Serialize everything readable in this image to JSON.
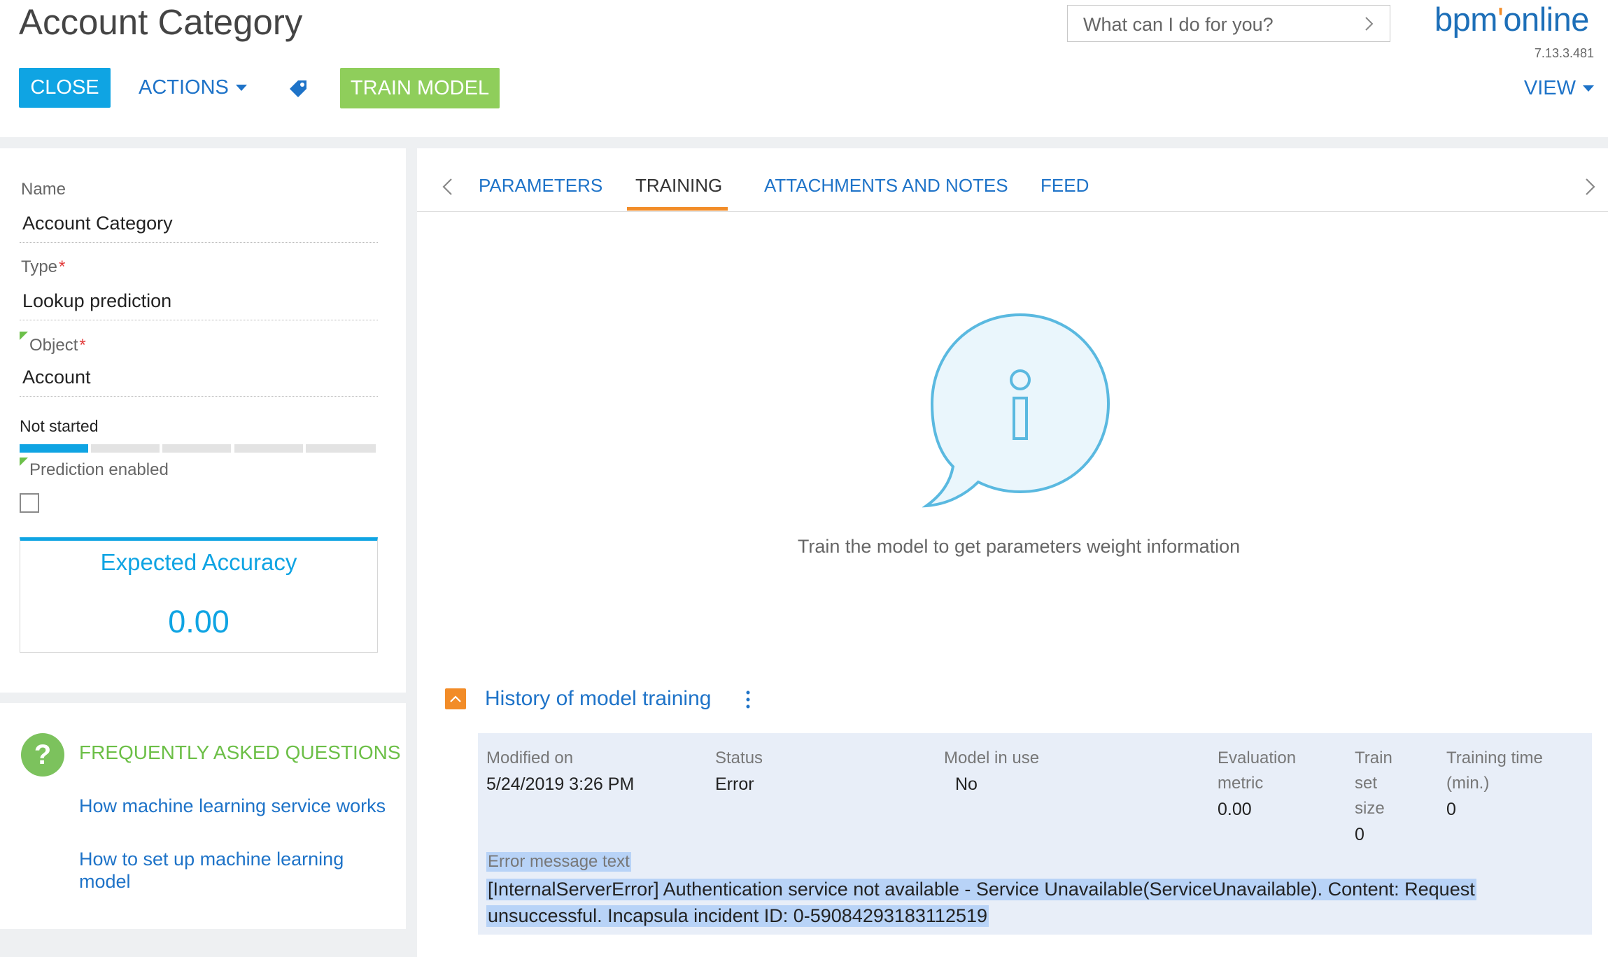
{
  "header": {
    "title": "Account Category",
    "close_label": "CLOSE",
    "actions_label": "ACTIONS",
    "train_label": "TRAIN MODEL",
    "search_placeholder": "What can I do for you?",
    "logo_part1": "bpm",
    "logo_part2": "online",
    "version": "7.13.3.481",
    "view_label": "VIEW"
  },
  "colors": {
    "accent_blue": "#0fa4e3",
    "link_blue": "#1e73c8",
    "green": "#8fce5b",
    "orange": "#f28c28",
    "required_red": "#e23b3b"
  },
  "fields": {
    "name_label": "Name",
    "name_value": "Account Category",
    "type_label": "Type",
    "type_value": "Lookup prediction",
    "object_label": "Object",
    "object_value": "Account",
    "required_mark": "*",
    "status_label": "Not started",
    "progress_stage": 1,
    "progress_total": 5,
    "prediction_label": "Prediction enabled",
    "prediction_checked": false
  },
  "accuracy": {
    "title": "Expected Accuracy",
    "value": "0.00"
  },
  "faq": {
    "icon": "question-icon",
    "title": "FREQUENTLY ASKED QUESTIONS",
    "links": [
      "How machine learning service works",
      "How to set up machine learning model"
    ]
  },
  "tabs": [
    {
      "label": "PARAMETERS",
      "active": false
    },
    {
      "label": "TRAINING",
      "active": true
    },
    {
      "label": "ATTACHMENTS AND NOTES",
      "active": false
    },
    {
      "label": "FEED",
      "active": false
    }
  ],
  "training": {
    "info_icon": "info-bubble-icon",
    "info_text": "Train the model to get parameters weight information"
  },
  "history": {
    "title": "History of model training",
    "columns": {
      "modified_on": "Modified on",
      "status": "Status",
      "model_in_use": "Model in use",
      "evaluation_metric_1": "Evaluation",
      "evaluation_metric_2": "metric",
      "train_set_size_1": "Train",
      "train_set_size_2": "set",
      "train_set_size_3": "size",
      "training_time_1": "Training time",
      "training_time_2": "(min.)"
    },
    "row": {
      "modified_on": "5/24/2019 3:26 PM",
      "status": "Error",
      "model_in_use": "No",
      "evaluation_metric": "0.00",
      "train_set_size": "0",
      "training_time": "0"
    },
    "error_label": "Error message text",
    "error_line1": "[InternalServerError] Authentication service not available - Service Unavailable(ServiceUnavailable). Content: Request",
    "error_line2": "unsuccessful. Incapsula incident ID: 0-59084293183112519"
  }
}
